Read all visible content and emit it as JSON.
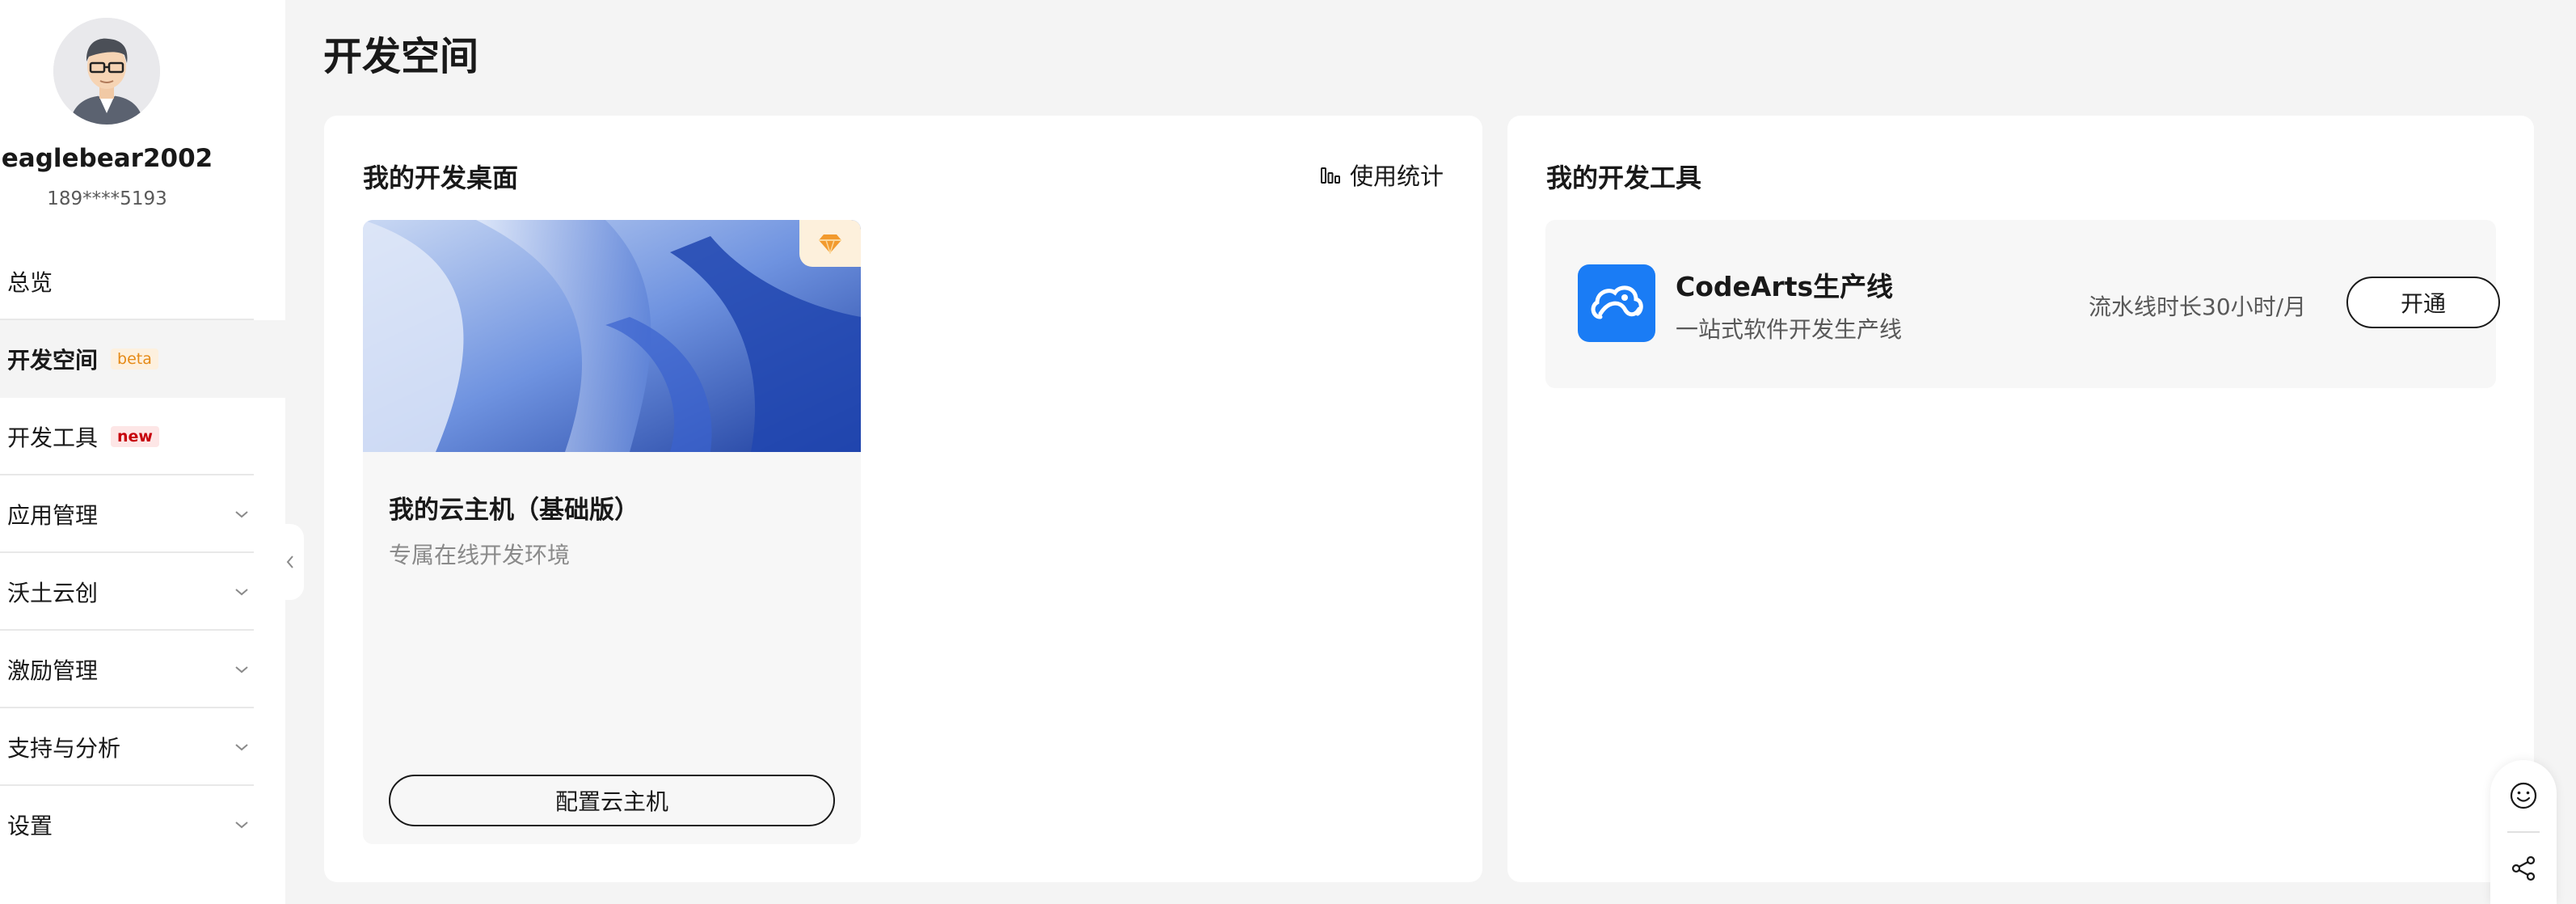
{
  "user": {
    "name": "eaglebear2002",
    "phone": "189****5193"
  },
  "sidebar": {
    "items": [
      {
        "label": "总览",
        "badge": "",
        "expandable": false
      },
      {
        "label": "开发空间",
        "badge": "beta",
        "expandable": false,
        "active": true
      },
      {
        "label": "开发工具",
        "badge": "new",
        "expandable": false
      },
      {
        "label": "应用管理",
        "badge": "",
        "expandable": true
      },
      {
        "label": "沃土云创",
        "badge": "",
        "expandable": true
      },
      {
        "label": "激励管理",
        "badge": "",
        "expandable": true
      },
      {
        "label": "支持与分析",
        "badge": "",
        "expandable": true
      },
      {
        "label": "设置",
        "badge": "",
        "expandable": true
      }
    ]
  },
  "page": {
    "title": "开发空间"
  },
  "desktop_panel": {
    "title": "我的开发桌面",
    "stats_link": "使用统计",
    "card": {
      "title": "我的云主机（基础版）",
      "subtitle": "专属在线开发环境",
      "button": "配置云主机",
      "tag_icon": "gem-icon"
    }
  },
  "tools_panel": {
    "title": "我的开发工具",
    "tools": [
      {
        "name": "CodeArts生产线",
        "description": "一站式软件开发生产线",
        "quota": "流水线时长30小时/月",
        "button": "开通",
        "icon": "cloud-icon"
      }
    ]
  },
  "colors": {
    "accent_blue": "#1a7cf5",
    "beta_badge": "#e58a17",
    "new_badge": "#c7000b"
  }
}
